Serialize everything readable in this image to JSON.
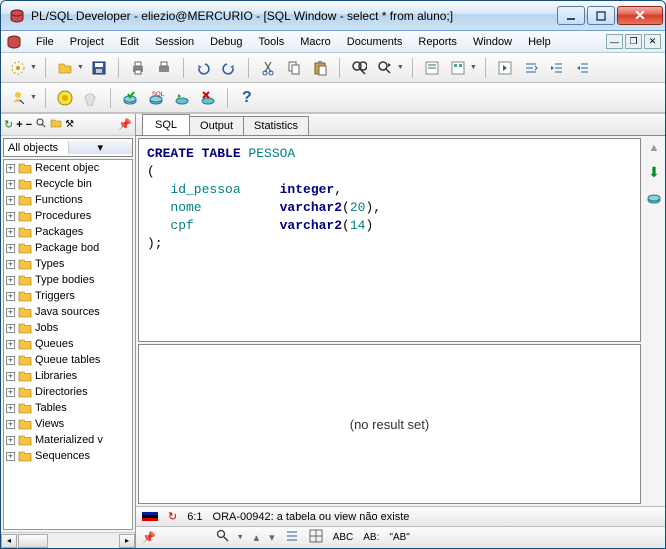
{
  "window": {
    "title": "PL/SQL Developer - eliezio@MERCURIO - [SQL Window - select * from aluno;]"
  },
  "menu": {
    "file": "File",
    "project": "Project",
    "edit": "Edit",
    "session": "Session",
    "debug": "Debug",
    "tools": "Tools",
    "macro": "Macro",
    "documents": "Documents",
    "reports": "Reports",
    "window": "Window",
    "help": "Help"
  },
  "objectBrowser": {
    "filter": "All objects",
    "items": [
      {
        "label": "Recent objec"
      },
      {
        "label": "Recycle bin"
      },
      {
        "label": "Functions"
      },
      {
        "label": "Procedures"
      },
      {
        "label": "Packages"
      },
      {
        "label": "Package bod"
      },
      {
        "label": "Types"
      },
      {
        "label": "Type bodies"
      },
      {
        "label": "Triggers"
      },
      {
        "label": "Java sources"
      },
      {
        "label": "Jobs"
      },
      {
        "label": "Queues"
      },
      {
        "label": "Queue tables"
      },
      {
        "label": "Libraries"
      },
      {
        "label": "Directories"
      },
      {
        "label": "Tables"
      },
      {
        "label": "Views"
      },
      {
        "label": "Materialized v"
      },
      {
        "label": "Sequences"
      }
    ]
  },
  "tabs": {
    "t1": "SQL",
    "t2": "Output",
    "t3": "Statistics"
  },
  "sql": {
    "l1a": "CREATE",
    "l1b": " TABLE ",
    "l1c": "PESSOA",
    "l2": "(",
    "l3a": "   id_pessoa     ",
    "l3b": "integer",
    "l3c": ",",
    "l4a": "   nome          ",
    "l4b": "varchar2",
    "l4c": "(",
    "l4d": "20",
    "l4e": "),",
    "l5a": "   cpf           ",
    "l5b": "varchar2",
    "l5c": "(",
    "l5d": "14",
    "l5e": ")",
    "l6": ");"
  },
  "result": {
    "empty": "(no result set)"
  },
  "status": {
    "pos": "6:1",
    "msg": "ORA-00942: a tabela ou view não existe"
  },
  "bottomIcons": {
    "abc1": "ABC",
    "abc2": "AB:",
    "ab": "\"AB\""
  }
}
